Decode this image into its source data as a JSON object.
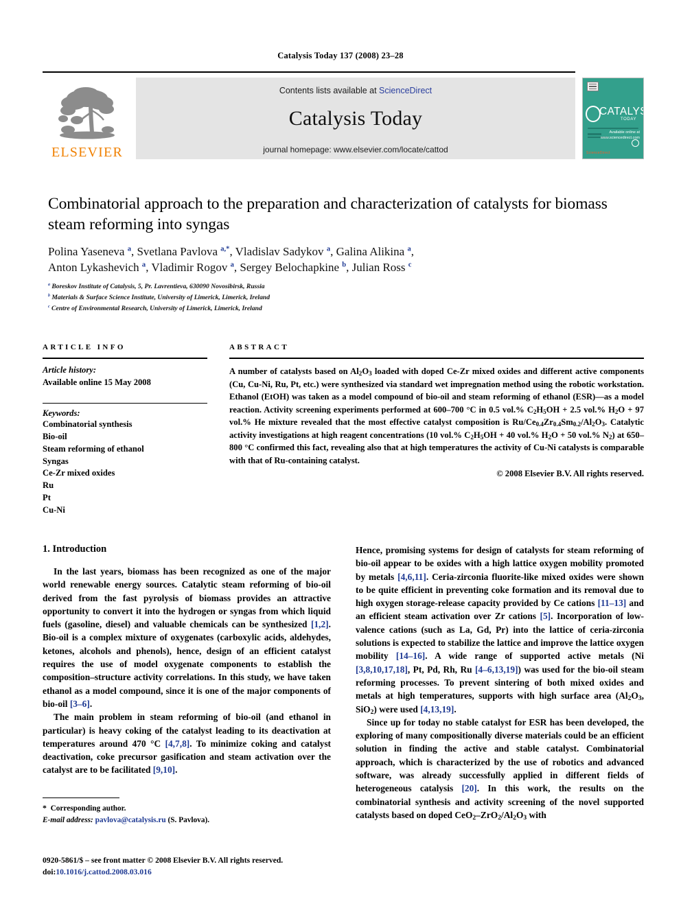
{
  "running_head": "Catalysis Today 137 (2008) 23–28",
  "masthead": {
    "contents_prefix": "Contents lists available at ",
    "sciencedirect": "ScienceDirect",
    "journal_name": "Catalysis Today",
    "homepage": "journal homepage: www.elsevier.com/locate/cattod",
    "publisher_wordmark": "ELSEVIER",
    "publisher_color": "#f08000",
    "band_color": "#e4e4e4",
    "cover": {
      "title": "CATALYSIS",
      "subtitle": "TODAY",
      "background_color": "#33a08c",
      "footer_text": "ScienceDirect",
      "brand_text": "Available online at\nScienceDirect\nwww.sciencedirect.com"
    }
  },
  "article": {
    "title": "Combinatorial approach to the preparation and characterization of catalysts for biomass steam reforming into syngas",
    "authors_line1": "Polina Yaseneva <sup>a</sup>, Svetlana Pavlova <sup>a,*</sup>, Vladislav Sadykov <sup>a</sup>, Galina Alikina <sup>a</sup>,",
    "authors_line2": "Anton Lykashevich <sup>a</sup>, Vladimir Rogov <sup>a</sup>, Sergey Belochapkine <sup>b</sup>, Julian Ross <sup>c</sup>",
    "affiliations": [
      "<sup>a</sup> Boreskov Institute of Catalysis, 5, Pr. Lavrentieva, 630090 Novosibirsk, Russia",
      "<sup>b</sup> Materials &amp; Surface Science Institute, University of Limerick, Limerick, Ireland",
      "<sup>c</sup> Centre of Environmental Research, University of Limerick, Limerick, Ireland"
    ]
  },
  "article_info": {
    "heading": "ARTICLE INFO",
    "history_label": "Article history:",
    "history_value": "Available online 15 May 2008",
    "keywords_label": "Keywords:",
    "keywords": [
      "Combinatorial synthesis",
      "Bio-oil",
      "Steam reforming of ethanol",
      "Syngas",
      "Ce-Zr mixed oxides",
      "Ru",
      "Pt",
      "Cu-Ni"
    ]
  },
  "abstract": {
    "heading": "ABSTRACT",
    "text": "A number of catalysts based on Al<sub>2</sub>O<sub>3</sub> loaded with doped Ce-Zr mixed oxides and different active components (Cu, Cu-Ni, Ru, Pt, etc.) were synthesized via standard wet impregnation method using the robotic workstation. Ethanol (EtOH) was taken as a model compound of bio-oil and steam reforming of ethanol (ESR)—as a model reaction. Activity screening experiments performed at 600–700 &deg;C in 0.5 vol.% C<sub>2</sub>H<sub>5</sub>OH + 2.5 vol.% H<sub>2</sub>O + 97 vol.% He mixture revealed that the most effective catalyst composition is Ru/Ce<sub>0.4</sub>Zr<sub>0.4</sub>Sm<sub>0.2</sub>/Al<sub>2</sub>O<sub>3</sub>. Catalytic activity investigations at high reagent concentrations (10 vol.% C<sub>2</sub>H<sub>5</sub>OH + 40 vol.% H<sub>2</sub>O + 50 vol.% N<sub>2</sub>) at 650–800 &deg;C confirmed this fact, revealing also that at high temperatures the activity of Cu-Ni catalysts is comparable with that of Ru-containing catalyst.",
    "copyright": "&copy; 2008 Elsevier B.V. All rights reserved."
  },
  "sections": {
    "introduction_heading": "1. Introduction",
    "left_paragraphs": [
      "In the last years, biomass has been recognized as one of the major world renewable energy sources. Catalytic steam reforming of bio-oil derived from the fast pyrolysis of biomass provides an attractive opportunity to convert it into the hydrogen or syngas from which liquid fuels (gasoline, diesel) and valuable chemicals can be synthesized <span class=\"ref\">[1,2]</span>. Bio-oil is a complex mixture of oxygenates (carboxylic acids, aldehydes, ketones, alcohols and phenols), hence, design of an efficient catalyst requires the use of model oxygenate components to establish the composition–structure activity correlations. In this study, we have taken ethanol as a model compound, since it is one of the major components of bio-oil <span class=\"ref\">[3–6]</span>.",
      "The main problem in steam reforming of bio-oil (and ethanol in particular) is heavy coking of the catalyst leading to its deactivation at temperatures around 470 &deg;C <span class=\"ref\">[4,7,8]</span>. To minimize coking and catalyst deactivation, coke precursor gasification and steam activation over the catalyst are to be facilitated <span class=\"ref\">[9,10]</span>."
    ],
    "right_paragraphs": [
      "Hence, promising systems for design of catalysts for steam reforming of bio-oil appear to be oxides with a high lattice oxygen mobility promoted by metals <span class=\"ref\">[4,6,11]</span>. Ceria-zirconia fluorite-like mixed oxides were shown to be quite efficient in preventing coke formation and its removal due to high oxygen storage-release capacity provided by Ce cations <span class=\"ref\">[11–13]</span> and an efficient steam activation over Zr cations <span class=\"ref\">[5]</span>. Incorporation of low-valence cations (such as La, Gd, Pr) into the lattice of ceria-zirconia solutions is expected to stabilize the lattice and improve the lattice oxygen mobility <span class=\"ref\">[14–16]</span>. A wide range of supported active metals (Ni <span class=\"ref\">[3,8,10,17,18]</span>, Pt, Pd, Rh, Ru <span class=\"ref\">[4–6,13,19]</span>) was used for the bio-oil steam reforming processes. To prevent sintering of both mixed oxides and metals at high temperatures, supports with high surface area (Al<sub>2</sub>O<sub>3</sub>, SiO<sub>2</sub>) were used <span class=\"ref\">[4,13,19]</span>.",
      "Since up for today no stable catalyst for ESR has been developed, the exploring of many compositionally diverse materials could be an efficient solution in finding the active and stable catalyst. Combinatorial approach, which is characterized by the use of robotics and advanced software, was already successfully applied in different fields of heterogeneous catalysis <span class=\"ref\">[20]</span>. In this work, the results on the combinatorial synthesis and activity screening of the novel supported catalysts based on doped CeO<sub>2</sub>–ZrO<sub>2</sub>/Al<sub>2</sub>O<sub>3</sub> with"
    ]
  },
  "footnotes": {
    "corresponding": "<span class=\"star\">*</span>&nbsp; Corresponding author.",
    "email": "<span class=\"it\">E-mail address:</span> <span class=\"mail\">pavlova@catalysis.ru</span> (S. Pavlova)."
  },
  "imprint": {
    "front_matter": "0920-5861/$ – see front matter &copy; 2008 Elsevier B.V. All rights reserved.",
    "doi_label": "doi:",
    "doi_value": "10.1016/j.cattod.2008.03.016"
  }
}
